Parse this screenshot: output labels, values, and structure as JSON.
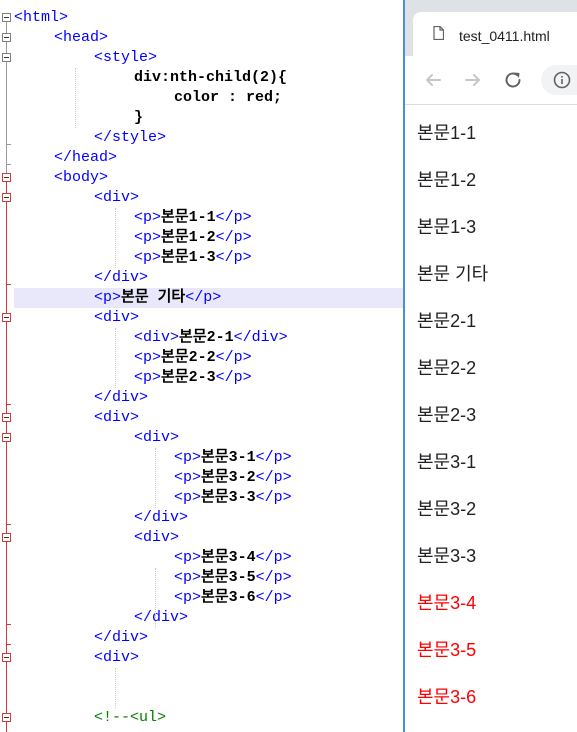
{
  "editor": {
    "lines": [
      {
        "indent": 0,
        "tokens": [
          {
            "t": "tag",
            "v": "<html>"
          }
        ]
      },
      {
        "indent": 1,
        "tokens": [
          {
            "t": "tag",
            "v": "<head>"
          }
        ]
      },
      {
        "indent": 2,
        "tokens": [
          {
            "t": "tag",
            "v": "<style>"
          }
        ]
      },
      {
        "indent": 3,
        "tokens": [
          {
            "t": "txt",
            "v": "div:nth-child(2){"
          }
        ]
      },
      {
        "indent": 4,
        "tokens": [
          {
            "t": "txt",
            "v": "color : red;"
          }
        ]
      },
      {
        "indent": 3,
        "tokens": [
          {
            "t": "txt",
            "v": "}"
          }
        ]
      },
      {
        "indent": 2,
        "tokens": [
          {
            "t": "tag",
            "v": "</style>"
          }
        ]
      },
      {
        "indent": 1,
        "tokens": [
          {
            "t": "tag",
            "v": "</head>"
          }
        ]
      },
      {
        "indent": 1,
        "tokens": [
          {
            "t": "tag",
            "v": "<body>"
          }
        ]
      },
      {
        "indent": 2,
        "tokens": [
          {
            "t": "tag",
            "v": "<div>"
          }
        ]
      },
      {
        "indent": 3,
        "tokens": [
          {
            "t": "tag",
            "v": "<p>"
          },
          {
            "t": "txt",
            "v": "본문1-1"
          },
          {
            "t": "tag",
            "v": "</p>"
          }
        ]
      },
      {
        "indent": 3,
        "tokens": [
          {
            "t": "tag",
            "v": "<p>"
          },
          {
            "t": "txt",
            "v": "본문1-2"
          },
          {
            "t": "tag",
            "v": "</p>"
          }
        ]
      },
      {
        "indent": 3,
        "tokens": [
          {
            "t": "tag",
            "v": "<p>"
          },
          {
            "t": "txt",
            "v": "본문1-3"
          },
          {
            "t": "tag",
            "v": "</p>"
          }
        ]
      },
      {
        "indent": 2,
        "tokens": [
          {
            "t": "tag",
            "v": "</div>"
          }
        ]
      },
      {
        "indent": 2,
        "highlight": true,
        "tokens": [
          {
            "t": "tag",
            "v": "<p>"
          },
          {
            "t": "txt",
            "v": "본문 기타"
          },
          {
            "t": "tag",
            "v": "</p>"
          }
        ]
      },
      {
        "indent": 2,
        "tokens": [
          {
            "t": "tag",
            "v": "<div>"
          }
        ]
      },
      {
        "indent": 3,
        "tokens": [
          {
            "t": "tag",
            "v": "<div>"
          },
          {
            "t": "txt",
            "v": "본문2-1"
          },
          {
            "t": "tag",
            "v": "</div>"
          }
        ]
      },
      {
        "indent": 3,
        "tokens": [
          {
            "t": "tag",
            "v": "<p>"
          },
          {
            "t": "txt",
            "v": "본문2-2"
          },
          {
            "t": "tag",
            "v": "</p>"
          }
        ]
      },
      {
        "indent": 3,
        "tokens": [
          {
            "t": "tag",
            "v": "<p>"
          },
          {
            "t": "txt",
            "v": "본문2-3"
          },
          {
            "t": "tag",
            "v": "</p>"
          }
        ]
      },
      {
        "indent": 2,
        "tokens": [
          {
            "t": "tag",
            "v": "</div>"
          }
        ]
      },
      {
        "indent": 2,
        "tokens": [
          {
            "t": "tag",
            "v": "<div>"
          }
        ]
      },
      {
        "indent": 3,
        "tokens": [
          {
            "t": "tag",
            "v": "<div>"
          }
        ]
      },
      {
        "indent": 4,
        "tokens": [
          {
            "t": "tag",
            "v": "<p>"
          },
          {
            "t": "txt",
            "v": "본문3-1"
          },
          {
            "t": "tag",
            "v": "</p>"
          }
        ]
      },
      {
        "indent": 4,
        "tokens": [
          {
            "t": "tag",
            "v": "<p>"
          },
          {
            "t": "txt",
            "v": "본문3-2"
          },
          {
            "t": "tag",
            "v": "</p>"
          }
        ]
      },
      {
        "indent": 4,
        "tokens": [
          {
            "t": "tag",
            "v": "<p>"
          },
          {
            "t": "txt",
            "v": "본문3-3"
          },
          {
            "t": "tag",
            "v": "</p>"
          }
        ]
      },
      {
        "indent": 3,
        "tokens": [
          {
            "t": "tag",
            "v": "</div>"
          }
        ]
      },
      {
        "indent": 3,
        "tokens": [
          {
            "t": "tag",
            "v": "<div>"
          }
        ]
      },
      {
        "indent": 4,
        "tokens": [
          {
            "t": "tag",
            "v": "<p>"
          },
          {
            "t": "txt",
            "v": "본문3-4"
          },
          {
            "t": "tag",
            "v": "</p>"
          }
        ]
      },
      {
        "indent": 4,
        "tokens": [
          {
            "t": "tag",
            "v": "<p>"
          },
          {
            "t": "txt",
            "v": "본문3-5"
          },
          {
            "t": "tag",
            "v": "</p>"
          }
        ]
      },
      {
        "indent": 4,
        "tokens": [
          {
            "t": "tag",
            "v": "<p>"
          },
          {
            "t": "txt",
            "v": "본문3-6"
          },
          {
            "t": "tag",
            "v": "</p>"
          }
        ]
      },
      {
        "indent": 3,
        "tokens": [
          {
            "t": "tag",
            "v": "</div>"
          }
        ]
      },
      {
        "indent": 2,
        "tokens": [
          {
            "t": "tag",
            "v": "</div>"
          }
        ]
      },
      {
        "indent": 2,
        "tokens": [
          {
            "t": "tag",
            "v": "<div>"
          }
        ]
      },
      {
        "indent": 2,
        "tokens": []
      },
      {
        "indent": 2,
        "tokens": []
      },
      {
        "indent": 2,
        "tokens": [
          {
            "t": "cmt",
            "v": "<!--<ul>"
          }
        ]
      }
    ]
  },
  "browser": {
    "tab_title": "test_0411.html",
    "tab_icon": "document-icon",
    "toolbar_icons": [
      "back-arrow-icon",
      "forward-arrow-icon",
      "reload-icon",
      "info-icon"
    ],
    "paragraphs": [
      {
        "text": "본문1-1",
        "color": "#202124"
      },
      {
        "text": "본문1-2",
        "color": "#202124"
      },
      {
        "text": "본문1-3",
        "color": "#202124"
      },
      {
        "text": "본문 기타",
        "color": "#202124"
      },
      {
        "text": "본문2-1",
        "color": "#202124"
      },
      {
        "text": "본문2-2",
        "color": "#202124"
      },
      {
        "text": "본문2-3",
        "color": "#202124"
      },
      {
        "text": "본문3-1",
        "color": "#202124"
      },
      {
        "text": "본문3-2",
        "color": "#202124"
      },
      {
        "text": "본문3-3",
        "color": "#202124"
      },
      {
        "text": "본문3-4",
        "color": "#ff0000"
      },
      {
        "text": "본문3-5",
        "color": "#ff0000"
      },
      {
        "text": "본문3-6",
        "color": "#ff0000"
      }
    ]
  },
  "colors": {
    "tag": "#0000ff",
    "text": "#000000",
    "comment": "#008000",
    "current_line": "#e8e8fa",
    "window_border": "#4a90d9",
    "fold_active": "#d23b3b"
  }
}
